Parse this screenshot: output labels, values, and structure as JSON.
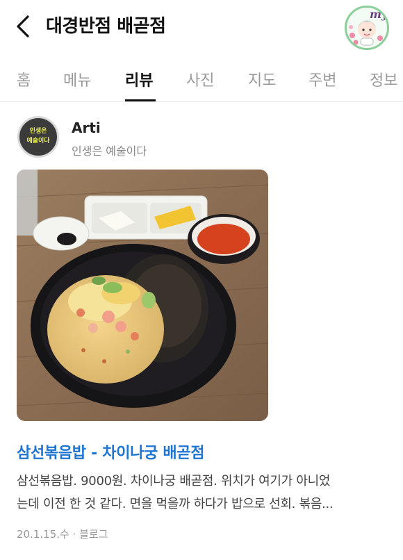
{
  "header": {
    "title": "대경반점 배곧점",
    "back_icon": "chevron-left-icon",
    "avatar_label": "my"
  },
  "tabs": [
    {
      "label": "홈",
      "active": false
    },
    {
      "label": "메뉴",
      "active": false
    },
    {
      "label": "리뷰",
      "active": true
    },
    {
      "label": "사진",
      "active": false
    },
    {
      "label": "지도",
      "active": false
    },
    {
      "label": "주변",
      "active": false
    },
    {
      "label": "정보",
      "active": false
    }
  ],
  "review": {
    "author": {
      "name": "Arti",
      "bio": "인생은 예술이다",
      "avatar_text_1": "인생은",
      "avatar_text_2": "예술이다"
    },
    "photo_icon": "food-photo",
    "title": "삼선볶음밥 - 차이나궁 배곧점",
    "snippet_line1": "삼선볶음밥. 9000원. 차이나궁 배곧점. 위치가 여기가 아니었",
    "snippet_line2": "는데 이전 한 것 같다. 면을 먹을까 하다가 밥으로 선회. 볶음...",
    "date": "20.1.15.수",
    "separator": "·",
    "source": "블로그"
  },
  "colors": {
    "link": "#1d74d1",
    "tab_active": "#111111",
    "tab_inactive": "#9a9a9a"
  }
}
